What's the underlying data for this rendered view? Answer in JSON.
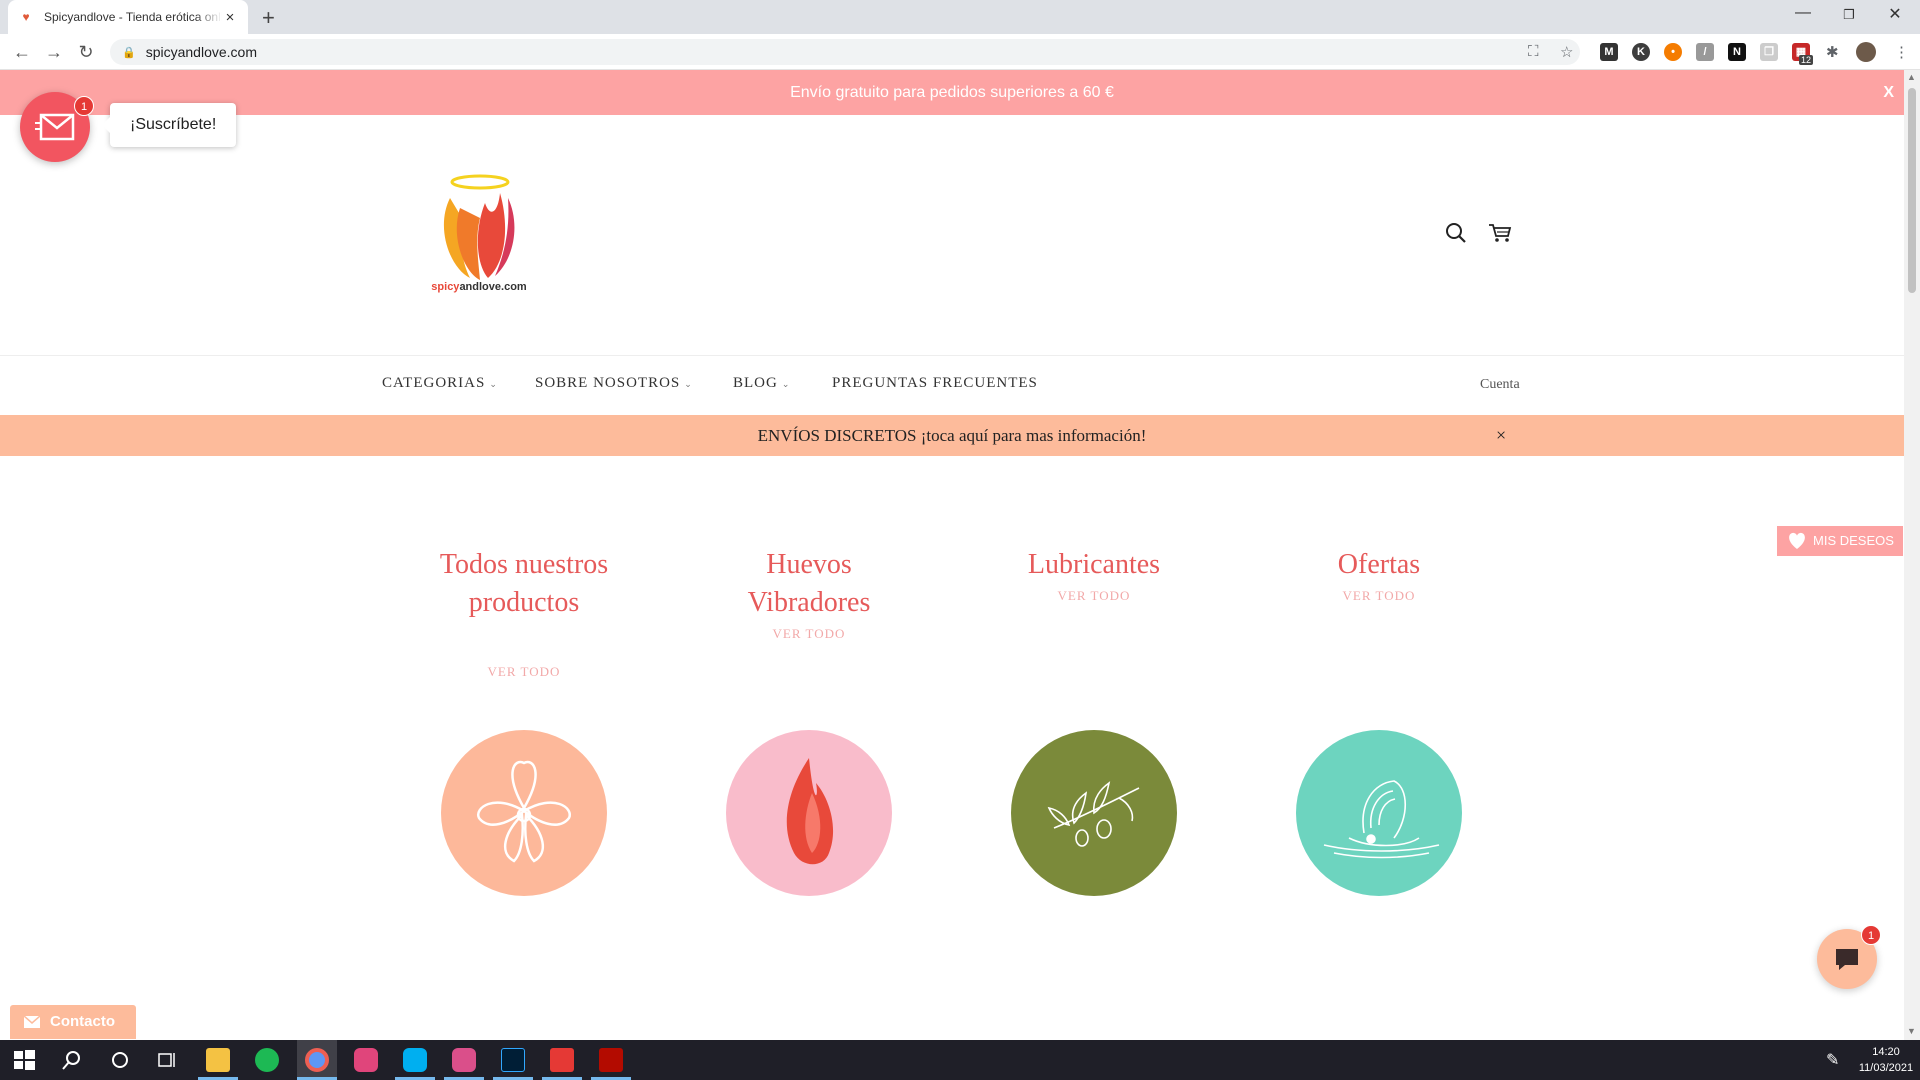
{
  "browser": {
    "tab_title": "Spicyandlove - Tienda erótica online",
    "url": "spicyandlove.com",
    "new_tab": "+",
    "close_tab": "×",
    "ext_badge": "12"
  },
  "announcement": {
    "text": "Envío gratuito para pedidos superiores a 60 €",
    "close": "X"
  },
  "subscribe": {
    "badge": "1",
    "tooltip": "¡Suscríbete!"
  },
  "logo": {
    "text_part1": "spicy",
    "text_part2": "andlove",
    "text_part3": ".com"
  },
  "nav": {
    "items": [
      {
        "label": "CATEGORIAS",
        "chevron": "⌄"
      },
      {
        "label": "SOBRE NOSOTROS",
        "chevron": "⌄"
      },
      {
        "label": "BLOG",
        "chevron": "⌄"
      },
      {
        "label": "PREGUNTAS FRECUENTES",
        "chevron": ""
      }
    ],
    "account": "Cuenta"
  },
  "discreet_bar": {
    "text": "ENVÍOS DISCRETOS ¡toca aquí para mas información!",
    "close": "×"
  },
  "categories": [
    {
      "title": "Todos nuestros productos",
      "link": "VER TODO",
      "color": "#fdb89a"
    },
    {
      "title": "Huevos Vibradores",
      "link": "VER TODO",
      "color": "#f9bccb"
    },
    {
      "title": "Lubricantes",
      "link": "VER TODO",
      "color": "#7b8a3a"
    },
    {
      "title": "Ofertas",
      "link": "VER TODO",
      "color": "#6dd4bf"
    }
  ],
  "wishlist": {
    "label": "MIS DESEOS"
  },
  "chat": {
    "badge": "1"
  },
  "contact": {
    "label": "Contacto"
  },
  "taskbar": {
    "time": "14:20",
    "date": "11/03/2021"
  },
  "colors": {
    "announce_bg": "#fda3a3",
    "discreet_bg": "#fdbb9b",
    "category_title": "#e65a5a",
    "category_link": "#f2a8a8"
  }
}
